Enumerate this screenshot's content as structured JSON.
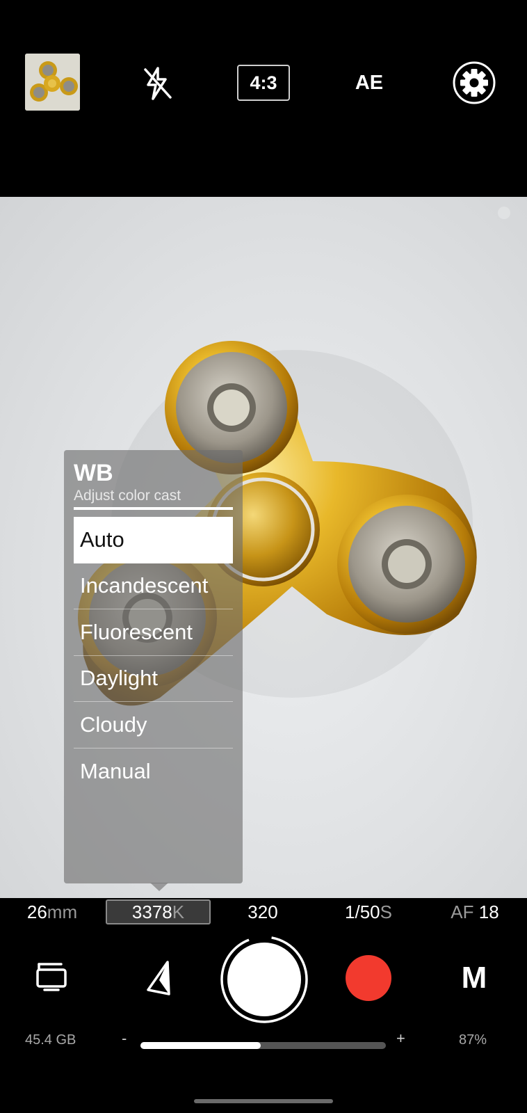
{
  "top_bar": {
    "thumbnail_icon": "fidget-spinner-thumbnail",
    "flash_icon": "flash-off-icon",
    "aspect_ratio": "4:3",
    "exposure_label": "AE",
    "settings_icon": "gear-icon"
  },
  "wb_panel": {
    "title": "WB",
    "subtitle": "Adjust color cast",
    "options": [
      "Auto",
      "Incandescent",
      "Fluorescent",
      "Daylight",
      "Cloudy",
      "Manual"
    ],
    "selected": "Auto"
  },
  "params": {
    "focal_value": "26",
    "focal_unit": "mm",
    "wb_value": "3378",
    "wb_unit": "K",
    "iso": "320",
    "shutter_value": "1/50",
    "shutter_unit": "S",
    "af_label": "AF",
    "af_value": "18"
  },
  "controls": {
    "gallery_icon": "gallery-icon",
    "focus_icon": "focus-point-icon",
    "shutter_icon": "shutter-button",
    "record_icon": "record-icon",
    "mode_label": "M"
  },
  "status": {
    "storage": "45.4 GB",
    "zoom_minus": "-",
    "zoom_plus": "+",
    "zoom_fraction": 0.49,
    "battery": "87%"
  },
  "colors": {
    "record": "#f23a2e",
    "accent": "#ffffff"
  }
}
